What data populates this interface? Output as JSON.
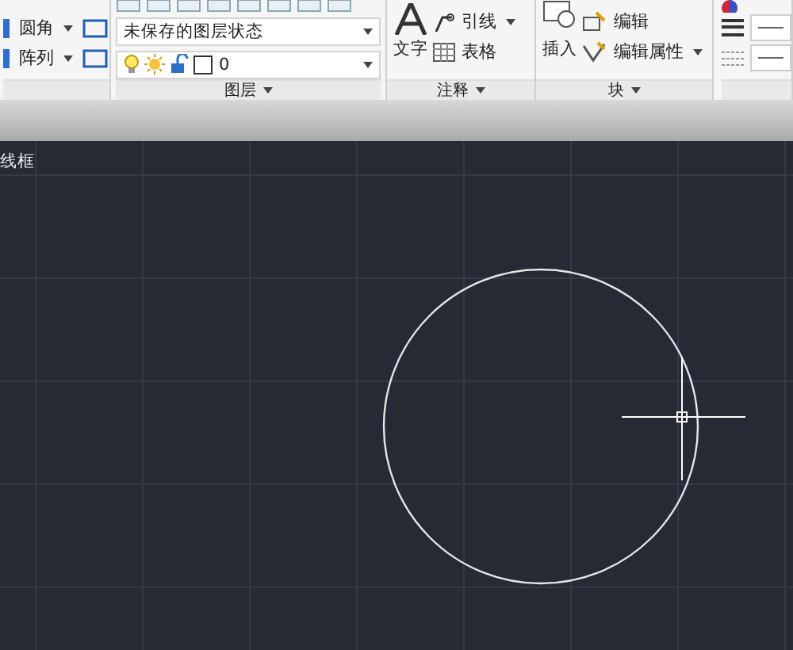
{
  "ribbon": {
    "modify_tools": [
      {
        "label": "圆角"
      },
      {
        "label": "阵列"
      }
    ],
    "layers": {
      "layer_state": "未保存的图层状态",
      "current_layer": "0",
      "panel_title": "图层"
    },
    "annotation": {
      "text_tool": "文字",
      "leader_tool": "引线",
      "table_tool": "表格",
      "panel_title": "注释"
    },
    "block": {
      "insert_tool": "插入",
      "edit_tool": "编辑",
      "edit_attributes_tool": "编辑属性",
      "panel_title": "块"
    }
  },
  "viewport": {
    "visual_style": "线框"
  }
}
